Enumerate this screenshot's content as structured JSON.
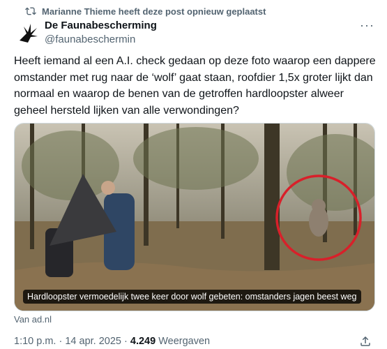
{
  "repost": {
    "text": "Marianne Thieme heeft deze post opnieuw geplaatst",
    "icon": "repost-icon"
  },
  "author": {
    "name": "De Faunabescherming",
    "handle": "@faunabeschermin"
  },
  "more_icon": "more-icon",
  "post": {
    "text": "Heeft iemand al een A.I. check gedaan op deze foto waarop een dappere omstander met rug naar de ‘wolf’ gaat staan, roofdier 1,5x groter lijkt dan normaal en waarop de benen van de getroffen hardloopster alweer geheel hersteld lijken van alle verwondingen?"
  },
  "media": {
    "caption": "Hardloopster vermoedelijk twee keer door wolf gebeten: omstanders jagen beest weg",
    "source": "Van ad.nl"
  },
  "meta": {
    "time": "1:10 p.m.",
    "separator1": " · ",
    "date": "14 apr. 2025",
    "separator2": " · ",
    "views_count": "4.249",
    "views_label": " Weergaven"
  },
  "colors": {
    "text": "#0f1419",
    "secondary": "#536471",
    "circle": "#d8202a"
  }
}
